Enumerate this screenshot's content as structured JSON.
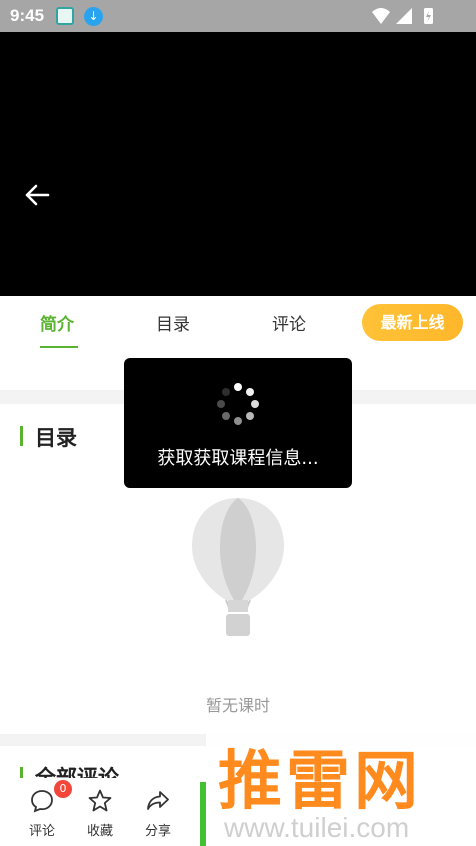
{
  "status_bar": {
    "time": "9:45",
    "app_icon": "notification-app-icon",
    "download_icon": "download-icon",
    "right_icons": [
      "wifi-icon",
      "signal-icon",
      "battery-icon"
    ]
  },
  "video": {
    "back_icon": "back-arrow-icon"
  },
  "tabs": {
    "intro": "简介",
    "catalog": "目录",
    "comments": "评论",
    "new_button": "最新上线"
  },
  "catalog_section": {
    "title": "目录",
    "empty_text": "暂无课时"
  },
  "comments_section": {
    "title": "全部评论"
  },
  "bottom_bar": {
    "comment_label": "评论",
    "comment_badge": "0",
    "favorite_label": "收藏",
    "share_label": "分享"
  },
  "loading_toast": {
    "message": "获取获取课程信息..."
  },
  "watermark": {
    "brand": "推雷网",
    "url": "www.tuilei.com"
  },
  "colors": {
    "accent_green": "#5ab330",
    "orange_button": "#ffbd33",
    "badge_red": "#f2463a"
  }
}
